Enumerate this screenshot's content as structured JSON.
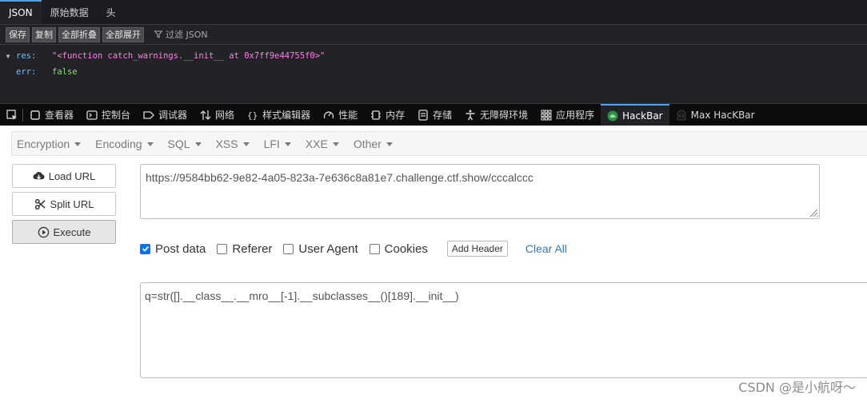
{
  "json_viewer": {
    "tabs": [
      {
        "label": "JSON",
        "active": true
      },
      {
        "label": "原始数据",
        "active": false
      },
      {
        "label": "头",
        "active": false
      }
    ],
    "toolbar": {
      "save": "保存",
      "copy": "复制",
      "collapse_all": "全部折叠",
      "expand_all": "全部展开",
      "filter": "过滤 JSON"
    },
    "rows": {
      "res_key": "res:",
      "res_value": "\"<function catch_warnings.__init__ at 0x7ff9e44755f0>\"",
      "err_key": "err:",
      "err_value": "false"
    }
  },
  "devtools": {
    "tabs": [
      {
        "label": "查看器",
        "icon": "inspector-icon"
      },
      {
        "label": "控制台",
        "icon": "console-icon"
      },
      {
        "label": "调试器",
        "icon": "debugger-icon"
      },
      {
        "label": "网络",
        "icon": "network-icon"
      },
      {
        "label": "样式编辑器",
        "icon": "style-editor-icon"
      },
      {
        "label": "性能",
        "icon": "performance-icon"
      },
      {
        "label": "内存",
        "icon": "memory-icon"
      },
      {
        "label": "存储",
        "icon": "storage-icon"
      },
      {
        "label": "无障碍环境",
        "icon": "accessibility-icon"
      },
      {
        "label": "应用程序",
        "icon": "application-icon"
      },
      {
        "label": "HackBar",
        "icon": "hackbar-icon",
        "active": true
      },
      {
        "label": "Max HacKBar",
        "icon": "max-hackbar-icon"
      }
    ]
  },
  "hackbar": {
    "menu": [
      "Encryption",
      "Encoding",
      "SQL",
      "XSS",
      "LFI",
      "XXE",
      "Other"
    ],
    "buttons": {
      "load_url": "Load URL",
      "split_url": "Split URL",
      "execute": "Execute"
    },
    "url_value": "https://9584bb62-9e82-4a05-823a-7e636c8a81e7.challenge.ctf.show/cccalccc",
    "options": {
      "post_data": "Post data",
      "post_data_checked": true,
      "referer": "Referer",
      "user_agent": "User Agent",
      "cookies": "Cookies",
      "add_header": "Add Header",
      "clear_all": "Clear All"
    },
    "post_value": "q=str([].__class__.__mro__[-1].__subclasses__()[189].__init__)"
  },
  "watermark": "CSDN @是小航呀～",
  "colors": {
    "accent": "#3fa6ff",
    "json_string": "#ff7de9",
    "json_bool": "#86de74",
    "json_key": "#75bfff",
    "link": "#337ab7",
    "checkbox": "#0075ff"
  }
}
